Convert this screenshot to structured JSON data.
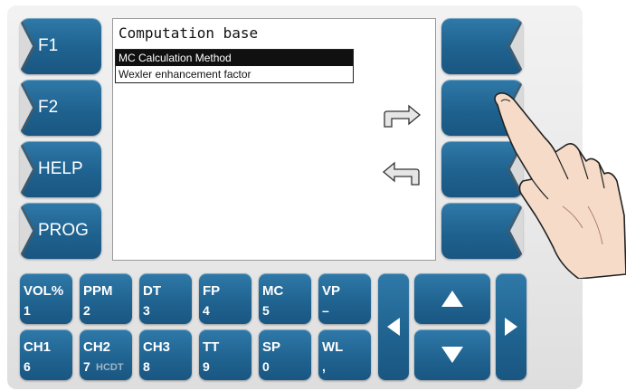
{
  "screen": {
    "title": "Computation base",
    "menu": [
      {
        "label": "MC Calculation Method",
        "selected": true
      },
      {
        "label": "Wexler enhancement factor",
        "selected": false
      }
    ]
  },
  "left_keys": [
    {
      "label": "F1"
    },
    {
      "label": "F2"
    },
    {
      "label": "HELP"
    },
    {
      "label": "PROG"
    }
  ],
  "keypad": {
    "row1": [
      {
        "top": "VOL%",
        "bottom": "1"
      },
      {
        "top": "PPM",
        "bottom": "2"
      },
      {
        "top": "DT",
        "bottom": "3"
      },
      {
        "top": "FP",
        "bottom": "4"
      },
      {
        "top": "MC",
        "bottom": "5"
      },
      {
        "top": "VP",
        "bottom": "–"
      }
    ],
    "row2": [
      {
        "top": "CH1",
        "bottom": "6",
        "sub": ""
      },
      {
        "top": "CH2",
        "bottom": "7",
        "sub": "HCDT"
      },
      {
        "top": "CH3",
        "bottom": "8",
        "sub": ""
      },
      {
        "top": "TT",
        "bottom": "9",
        "sub": ""
      },
      {
        "top": "SP",
        "bottom": "0",
        "sub": ""
      },
      {
        "top": "WL",
        "bottom": ",",
        "sub": ""
      }
    ]
  },
  "icons": {
    "enter": "arrow-enter-icon",
    "back": "arrow-back-icon",
    "up": "triangle-up-icon",
    "down": "triangle-down-icon",
    "left": "triangle-left-icon",
    "right": "triangle-right-icon",
    "hand": "pointing-hand-icon"
  },
  "colors": {
    "key_blue": "#1f628f",
    "panel_gray": "#e9e9e9",
    "selected_bg": "#101010"
  }
}
